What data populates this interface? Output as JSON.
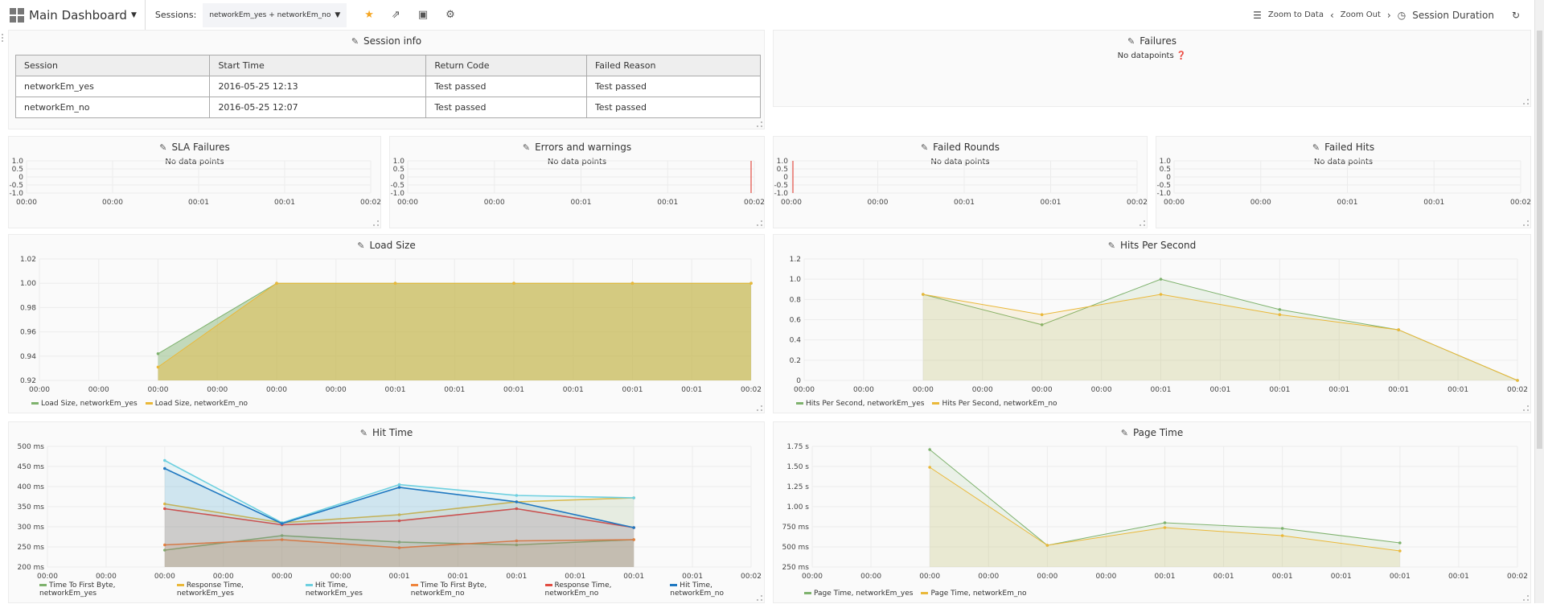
{
  "topbar": {
    "dashboard": "Main Dashboard",
    "sessions_label": "Sessions:",
    "sessions_value": "networkEm_yes + networkEm_no",
    "icons": [
      "star-icon",
      "share-icon",
      "save-icon",
      "gear-icon"
    ],
    "zoom_to_data": "Zoom to Data",
    "zoom_out": "Zoom Out",
    "session_duration": "Session Duration"
  },
  "session_info": {
    "title": "Session info",
    "columns": [
      "Session",
      "Start Time",
      "Return Code",
      "Failed Reason"
    ],
    "rows": [
      [
        "networkEm_yes",
        "2016-05-25 12:13",
        "Test passed",
        "Test passed"
      ],
      [
        "networkEm_no",
        "2016-05-25 12:07",
        "Test passed",
        "Test passed"
      ]
    ]
  },
  "failures": {
    "title": "Failures",
    "message": "No datapoints"
  },
  "colors": {
    "green": "#7eb26d",
    "yellow": "#eab839",
    "cyan": "#6ed0e0",
    "orange": "#ef843c",
    "red": "#e24d42",
    "blue": "#1f78c1"
  },
  "chart_data": [
    {
      "id": "sla",
      "type": "line",
      "title": "SLA Failures",
      "message": "No data points",
      "yticks": [
        "1.0",
        "0.5",
        "0",
        "-0.5",
        "-1.0"
      ],
      "ylim": [
        -1,
        1
      ],
      "xticks": [
        "00:00",
        "00:00",
        "00:01",
        "00:01",
        "00:02"
      ],
      "series": []
    },
    {
      "id": "errors",
      "type": "line",
      "title": "Errors and warnings",
      "message": "No data points",
      "yticks": [
        "1.0",
        "0.5",
        "0",
        "-0.5",
        "-1.0"
      ],
      "ylim": [
        -1,
        1
      ],
      "xticks": [
        "00:00",
        "00:00",
        "00:01",
        "00:01",
        "00:02"
      ],
      "series": [],
      "marker_at": "end"
    },
    {
      "id": "rounds",
      "type": "line",
      "title": "Failed Rounds",
      "message": "No data points",
      "yticks": [
        "1.0",
        "0.5",
        "0",
        "-0.5",
        "-1.0"
      ],
      "ylim": [
        -1,
        1
      ],
      "xticks": [
        "00:00",
        "00:00",
        "00:01",
        "00:01",
        "00:02"
      ],
      "series": [],
      "marker_at": "start"
    },
    {
      "id": "hits",
      "type": "line",
      "title": "Failed Hits",
      "message": "No data points",
      "yticks": [
        "1.0",
        "0.5",
        "0",
        "-0.5",
        "-1.0"
      ],
      "ylim": [
        -1,
        1
      ],
      "xticks": [
        "00:00",
        "00:00",
        "00:01",
        "00:01",
        "00:02"
      ],
      "series": []
    },
    {
      "id": "load",
      "type": "area",
      "title": "Load Size",
      "ylim": [
        0.92,
        1.02
      ],
      "yticks": [
        "1.02",
        "1.00",
        "0.98",
        "0.96",
        "0.94",
        "0.92"
      ],
      "xticks": [
        "00:00",
        "00:00",
        "00:00",
        "00:00",
        "00:00",
        "00:00",
        "00:01",
        "00:01",
        "00:01",
        "00:01",
        "00:01",
        "00:01",
        "00:02"
      ],
      "x_index": [
        2,
        4,
        6,
        8,
        10,
        12
      ],
      "series": [
        {
          "name": "Load Size, networkEm_yes",
          "color": "#7eb26d",
          "values": [
            0.942,
            1,
            1,
            1,
            1,
            1
          ]
        },
        {
          "name": "Load Size, networkEm_no",
          "color": "#eab839",
          "values": [
            0.931,
            1,
            1,
            1,
            1,
            1
          ]
        }
      ]
    },
    {
      "id": "hps",
      "type": "area",
      "title": "Hits Per Second",
      "ylim": [
        0,
        1.2
      ],
      "yticks": [
        "1.2",
        "1.0",
        "0.8",
        "0.6",
        "0.4",
        "0.2",
        "0"
      ],
      "xticks": [
        "00:00",
        "00:00",
        "00:00",
        "00:00",
        "00:00",
        "00:00",
        "00:01",
        "00:01",
        "00:01",
        "00:01",
        "00:01",
        "00:01",
        "00:02"
      ],
      "x_index": [
        2,
        4,
        6,
        8,
        10,
        12
      ],
      "series": [
        {
          "name": "Hits Per Second, networkEm_yes",
          "color": "#7eb26d",
          "values": [
            0.85,
            0.55,
            1.0,
            0.7,
            0.5,
            0
          ]
        },
        {
          "name": "Hits Per Second, networkEm_no",
          "color": "#eab839",
          "values": [
            0.85,
            0.65,
            0.85,
            0.65,
            0.5,
            0
          ]
        }
      ]
    },
    {
      "id": "hittime",
      "type": "area",
      "title": "Hit Time",
      "ylim": [
        200,
        500
      ],
      "yticks": [
        "500 ms",
        "450 ms",
        "400 ms",
        "350 ms",
        "300 ms",
        "250 ms",
        "200 ms"
      ],
      "xticks": [
        "00:00",
        "00:00",
        "00:00",
        "00:00",
        "00:00",
        "00:00",
        "00:01",
        "00:01",
        "00:01",
        "00:01",
        "00:01",
        "00:01",
        "00:02"
      ],
      "x_index": [
        2,
        4,
        6,
        8,
        10
      ],
      "series": [
        {
          "name": "Time To First Byte, networkEm_yes",
          "color": "#7eb26d",
          "values": [
            242,
            278,
            262,
            255,
            268
          ]
        },
        {
          "name": "Response Time, networkEm_yes",
          "color": "#eab839",
          "values": [
            357,
            310,
            330,
            362,
            372
          ]
        },
        {
          "name": "Hit Time, networkEm_yes",
          "color": "#6ed0e0",
          "values": [
            465,
            310,
            405,
            378,
            372
          ]
        },
        {
          "name": "Time To First Byte, networkEm_no",
          "color": "#ef843c",
          "values": [
            255,
            268,
            248,
            265,
            268
          ]
        },
        {
          "name": "Response Time, networkEm_no",
          "color": "#e24d42",
          "values": [
            345,
            305,
            315,
            345,
            298
          ]
        },
        {
          "name": "Hit Time, networkEm_no",
          "color": "#1f78c1",
          "values": [
            445,
            308,
            398,
            362,
            298
          ]
        }
      ]
    },
    {
      "id": "pagetime",
      "type": "area",
      "title": "Page Time",
      "ylim": [
        0.25,
        1.75
      ],
      "yticks": [
        "1.75 s",
        "1.50 s",
        "1.25 s",
        "1.00 s",
        "750 ms",
        "500 ms",
        "250 ms"
      ],
      "xticks": [
        "00:00",
        "00:00",
        "00:00",
        "00:00",
        "00:00",
        "00:00",
        "00:01",
        "00:01",
        "00:01",
        "00:01",
        "00:01",
        "00:01",
        "00:02"
      ],
      "x_index": [
        2,
        4,
        6,
        8,
        10
      ],
      "series": [
        {
          "name": "Page Time, networkEm_yes",
          "color": "#7eb26d",
          "values": [
            1.71,
            0.52,
            0.8,
            0.73,
            0.55
          ]
        },
        {
          "name": "Page Time, networkEm_no",
          "color": "#eab839",
          "values": [
            1.49,
            0.52,
            0.74,
            0.64,
            0.45
          ]
        }
      ]
    }
  ]
}
